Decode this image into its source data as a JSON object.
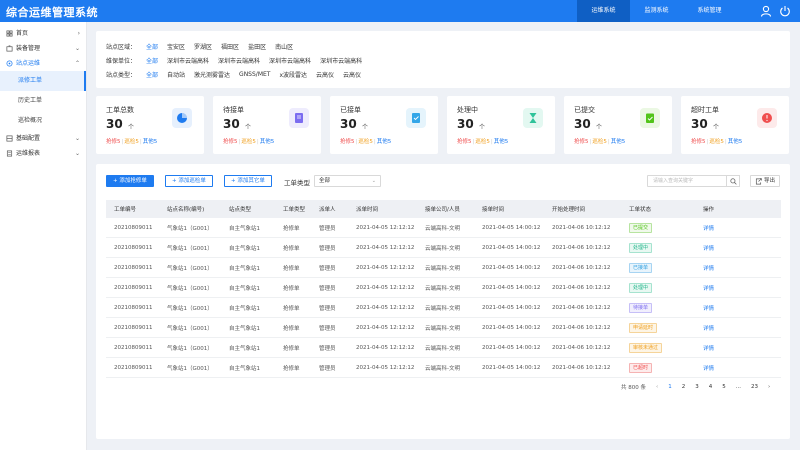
{
  "header": {
    "title": "综合运维管理系统",
    "tabs": [
      {
        "label": "运维系统",
        "active": true
      },
      {
        "label": "监测系统",
        "active": false
      },
      {
        "label": "系统管理",
        "active": false
      }
    ],
    "icons": [
      "user-icon",
      "logout-icon"
    ]
  },
  "sidebar": {
    "items": [
      {
        "label": "首页",
        "icon": "home-icon",
        "arrow": "›"
      },
      {
        "label": "装备管理",
        "icon": "equipment-icon",
        "arrow": "⌄"
      },
      {
        "label": "站点运维",
        "icon": "station-icon",
        "arrow": "⌃",
        "color": "#1e7bf0"
      }
    ],
    "sub_items": [
      {
        "label": "派修工单",
        "active": true
      },
      {
        "label": "历史工单",
        "active": false
      },
      {
        "label": "巡检概况",
        "active": false
      }
    ],
    "bottom_items": [
      {
        "label": "基础配置",
        "icon": "config-icon",
        "arrow": "⌄"
      },
      {
        "label": "运维报表",
        "icon": "report-icon",
        "arrow": "⌄"
      }
    ]
  },
  "filter": {
    "rows": [
      {
        "label": "站点区域：",
        "options": [
          "全部",
          "宝安区",
          "罗湖区",
          "福田区",
          "盐田区",
          "南山区"
        ]
      },
      {
        "label": "维保单位：",
        "options": [
          "全部",
          "深圳市云端高科",
          "深圳市云端高科",
          "深圳市云端高科",
          "深圳市云端高科"
        ]
      },
      {
        "label": "站点类型：",
        "options": [
          "全部",
          "自动站",
          "激光测雾雷达",
          "GNSS/MET",
          "x波段雷达",
          "云高仪",
          "云高仪"
        ]
      }
    ]
  },
  "cards": [
    {
      "label": "工单总数",
      "value": "30",
      "unit": "个",
      "sub": [
        "抢修5",
        "巡检5",
        "其他5"
      ],
      "icon": "pie-chart-icon",
      "color": "#1e7bf0",
      "bg": "#e6f0fd"
    },
    {
      "label": "待接单",
      "value": "30",
      "unit": "个",
      "sub": [
        "抢修5",
        "巡检5",
        "其他5"
      ],
      "icon": "pending-document-icon",
      "color": "#7b6cf0",
      "bg": "#eeecfd"
    },
    {
      "label": "已接单",
      "value": "30",
      "unit": "个",
      "sub": [
        "抢修5",
        "巡检5",
        "其他5"
      ],
      "icon": "accepted-document-icon",
      "color": "#33a6e8",
      "bg": "#e5f4fc"
    },
    {
      "label": "处理中",
      "value": "30",
      "unit": "个",
      "sub": [
        "抢修5",
        "巡检5",
        "其他5"
      ],
      "icon": "hourglass-icon",
      "color": "#2fc39a",
      "bg": "#e3f8f1"
    },
    {
      "label": "已提交",
      "value": "30",
      "unit": "个",
      "sub": [
        "抢修5",
        "巡检5",
        "其他5"
      ],
      "icon": "clipboard-check-icon",
      "color": "#52c41a",
      "bg": "#ebf8e3"
    },
    {
      "label": "超时工单",
      "value": "30",
      "unit": "个",
      "sub": [
        "抢修5",
        "巡检5",
        "其他5"
      ],
      "icon": "timeout-icon",
      "color": "#f04f4f",
      "bg": "#fdeaea"
    }
  ],
  "toolbar": {
    "btn_add_repair": "+ 添加抢修单",
    "btn_add_inspect": "+ 添加巡检单",
    "btn_add_other": "+ 添加其它单",
    "type_label": "工单类型",
    "type_value": "全部",
    "search_placeholder": "请输入查询关键字",
    "export_label": "导出"
  },
  "table": {
    "columns": [
      "工单编号",
      "站点名称(编号)",
      "站点类型",
      "工单类型",
      "派单人",
      "派单时间",
      "接单公司/人员",
      "接单时间",
      "开始处理时间",
      "工单状态",
      "操作"
    ],
    "rows": [
      {
        "id": "20210809011",
        "station": "气象站1（G001）",
        "stype": "自主气象站1",
        "otype": "抢修单",
        "dispatcher": "管理员",
        "dtime": "2021-04-05 12:12:12",
        "company": "云端高科-文明",
        "atime": "2021-04-05 14:00:12",
        "stime": "2021-04-06 10:12:12",
        "status": "已提交",
        "sfg": "#52c41a",
        "sbg": "#f0f9eb",
        "sbd": "#b7e4a0",
        "action": "详情"
      },
      {
        "id": "20210809011",
        "station": "气象站1（G001）",
        "stype": "自主气象站1",
        "otype": "抢修单",
        "dispatcher": "管理员",
        "dtime": "2021-04-05 12:12:12",
        "company": "云端高科-文明",
        "atime": "2021-04-05 14:00:12",
        "stime": "2021-04-06 10:12:12",
        "status": "处理中",
        "sfg": "#1fb58a",
        "sbg": "#e8f8f2",
        "sbd": "#a6e3cf",
        "action": "详情"
      },
      {
        "id": "20210809011",
        "station": "气象站1（G001）",
        "stype": "自主气象站1",
        "otype": "抢修单",
        "dispatcher": "管理员",
        "dtime": "2021-04-05 12:12:12",
        "company": "云端高科-文明",
        "atime": "2021-04-05 14:00:12",
        "stime": "2021-04-06 10:12:12",
        "status": "已接单",
        "sfg": "#2d9fe0",
        "sbg": "#e8f4fc",
        "sbd": "#a7d4f2",
        "action": "详情"
      },
      {
        "id": "20210809011",
        "station": "气象站1（G001）",
        "stype": "自主气象站1",
        "otype": "抢修单",
        "dispatcher": "管理员",
        "dtime": "2021-04-05 12:12:12",
        "company": "云端高科-文明",
        "atime": "2021-04-05 14:00:12",
        "stime": "2021-04-06 10:12:12",
        "status": "处理中",
        "sfg": "#1fb58a",
        "sbg": "#e8f8f2",
        "sbd": "#a6e3cf",
        "action": "详情"
      },
      {
        "id": "20210809011",
        "station": "气象站1（G001）",
        "stype": "自主气象站1",
        "otype": "抢修单",
        "dispatcher": "管理员",
        "dtime": "2021-04-05 12:12:12",
        "company": "云端高科-文明",
        "atime": "2021-04-05 14:00:12",
        "stime": "2021-04-06 10:12:12",
        "status": "待接单",
        "sfg": "#7b6cf0",
        "sbg": "#f1effd",
        "sbd": "#c6bff7",
        "action": "详情"
      },
      {
        "id": "20210809011",
        "station": "气象站1（G001）",
        "stype": "自主气象站1",
        "otype": "抢修单",
        "dispatcher": "管理员",
        "dtime": "2021-04-05 12:12:12",
        "company": "云端高科-文明",
        "atime": "2021-04-05 14:00:12",
        "stime": "2021-04-06 10:12:12",
        "status": "申请延时",
        "sfg": "#f0a020",
        "sbg": "#fdf5e6",
        "sbd": "#f5d49a",
        "action": "详情"
      },
      {
        "id": "20210809011",
        "station": "气象站1（G001）",
        "stype": "自主气象站1",
        "otype": "抢修单",
        "dispatcher": "管理员",
        "dtime": "2021-04-05 12:12:12",
        "company": "云端高科-文明",
        "atime": "2021-04-05 14:00:12",
        "stime": "2021-04-06 10:12:12",
        "status": "审核未通过",
        "sfg": "#f0a020",
        "sbg": "#fdf5e6",
        "sbd": "#f5d49a",
        "action": "详情"
      },
      {
        "id": "20210809011",
        "station": "气象站1（G001）",
        "stype": "自主气象站1",
        "otype": "抢修单",
        "dispatcher": "管理员",
        "dtime": "2021-04-05 12:12:12",
        "company": "云端高科-文明",
        "atime": "2021-04-05 14:00:12",
        "stime": "2021-04-06 10:12:12",
        "status": "已超时",
        "sfg": "#f04f4f",
        "sbg": "#fdecec",
        "sbd": "#f5b3b3",
        "action": "详情"
      }
    ]
  },
  "pagination": {
    "total": "共 800 条",
    "prev": "‹",
    "pages": [
      "1",
      "2",
      "3",
      "4",
      "5",
      "...",
      "23"
    ],
    "current": "1",
    "next": "›"
  }
}
